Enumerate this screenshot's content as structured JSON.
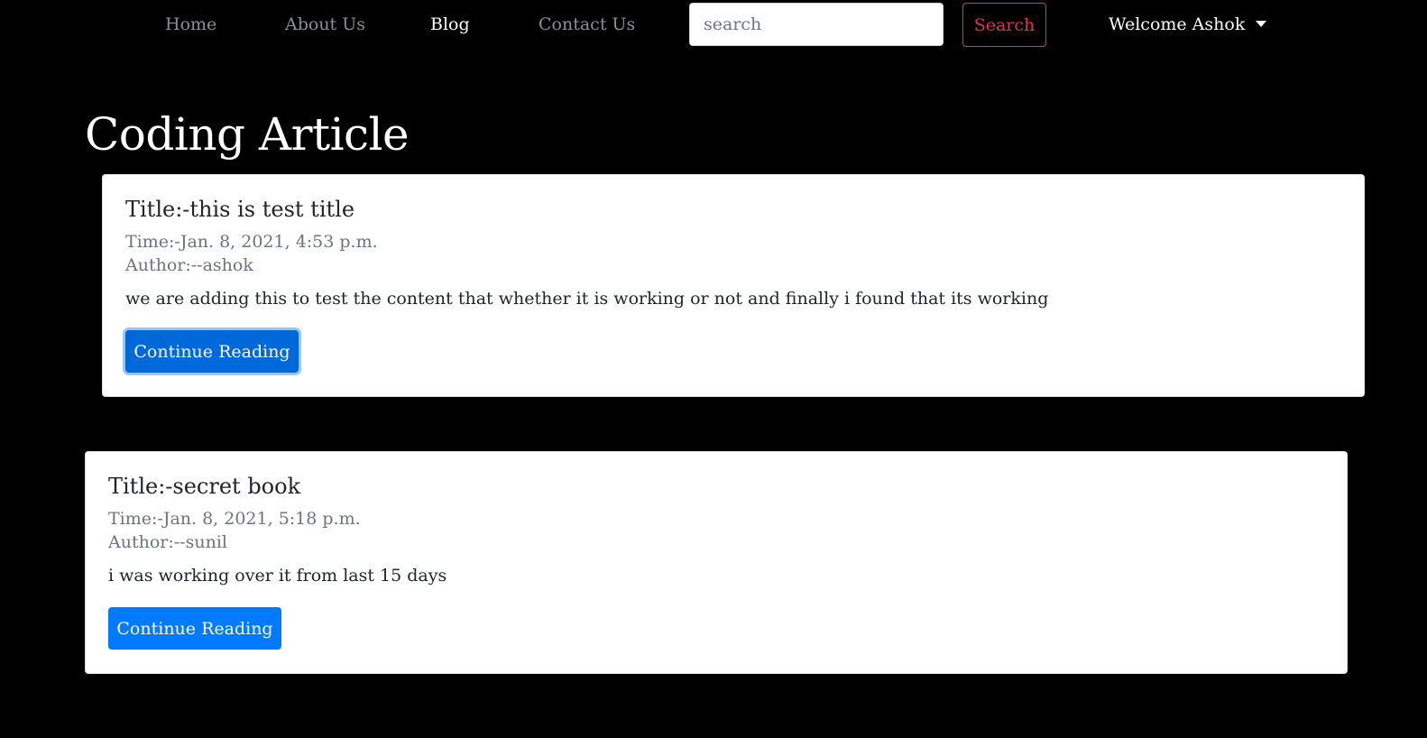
{
  "nav": {
    "items": [
      {
        "label": "Home",
        "active": false
      },
      {
        "label": "About Us",
        "active": false
      },
      {
        "label": "Blog",
        "active": true
      },
      {
        "label": "Contact Us",
        "active": false
      }
    ],
    "search": {
      "placeholder": "search",
      "value": "",
      "button_label": "Search"
    },
    "user": {
      "label": "Welcome Ashok",
      "icon": "caret-down-icon"
    }
  },
  "main": {
    "title": "Coding Article",
    "articles": [
      {
        "title": "Title:-this is test title",
        "time": "Time:-Jan. 8, 2021, 4:53 p.m.",
        "author": "Author:--ashok",
        "content": "we are adding this to test the content that whether it is working or not and finally i found that its working",
        "button_label": "Continue Reading"
      },
      {
        "title": "Title:-secret book",
        "time": "Time:-Jan. 8, 2021, 5:18 p.m.",
        "author": "Author:--sunil",
        "content": "i was working over it from last 15 days",
        "button_label": "Continue Reading"
      }
    ]
  },
  "colors": {
    "background": "#000000",
    "nav_inactive": "#8a8f94",
    "nav_active": "#ffffff",
    "search_button": "#dc3545",
    "primary": "#007bff",
    "muted_text": "#6c757d"
  }
}
